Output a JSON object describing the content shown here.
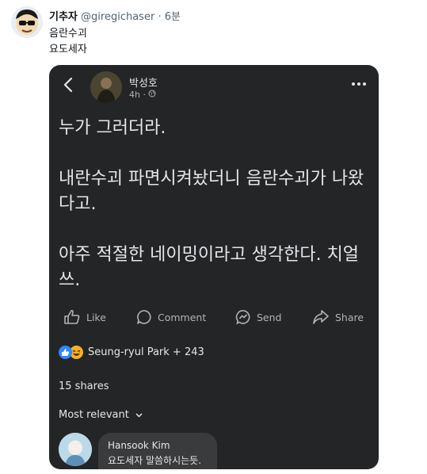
{
  "tweet": {
    "display_name": "기추자",
    "handle": "@giregichaser",
    "separator": "·",
    "time": "6분",
    "line1": "음란수괴",
    "line2": "요도세자"
  },
  "fb_post": {
    "author": "박성호",
    "time": "4h ·",
    "text": "누가 그러더라.\n\n내란수괴 파면시켜놨더니 음란수괴가 나왔다고.\n\n아주 적절한 네이밍이라고 생각한다. 치얼쓰.",
    "actions": {
      "like": "Like",
      "comment": "Comment",
      "send": "Send",
      "share": "Share"
    },
    "reactions_text": "Seung-ryul Park + 243",
    "shares": "15 shares",
    "sort_label": "Most relevant",
    "comment": {
      "author": "Hansook Kim",
      "text": "요도세자 말씀하시는듯."
    }
  },
  "colors": {
    "card_bg": "#242526",
    "like_blue": "#2d88ff",
    "haha_yellow": "#f7b125",
    "muted": "#b0b3b8"
  }
}
